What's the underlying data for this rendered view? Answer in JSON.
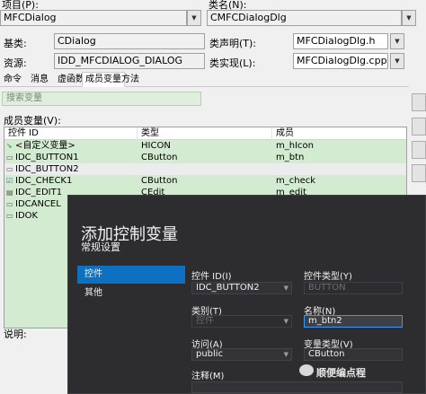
{
  "wizard": {
    "project_label": "项目(P):",
    "project_value": "MFCDialog",
    "classname_label": "类名(N):",
    "classname_value": "CMFCDialogDlg",
    "base_label": "基类:",
    "base_value": "CDialog",
    "header_label": "类声明(T):",
    "header_value": "MFCDialogDlg.h",
    "resource_label": "资源:",
    "resource_value": "IDD_MFCDIALOG_DIALOG",
    "impl_label": "类实现(L):",
    "impl_value": "MFCDialogDlg.cpp",
    "tabs": [
      "命令",
      "消息",
      "虚函数",
      "成员变量",
      "方法"
    ],
    "active_tab": "成员变量",
    "search_placeholder": "搜索变量",
    "member_vars_label": "成员变量(V):",
    "columns": [
      "控件 ID",
      "类型",
      "成员"
    ],
    "rows": [
      {
        "id": "<自定义变量>",
        "type": "HICON",
        "member": "m_hIcon",
        "icon": "green-arrow-icon"
      },
      {
        "id": "IDC_BUTTON1",
        "type": "CButton",
        "member": "m_btn",
        "icon": "button-control-icon"
      },
      {
        "id": "IDC_BUTTON2",
        "type": "",
        "member": "",
        "icon": "button-control-icon"
      },
      {
        "id": "IDC_CHECK1",
        "type": "CButton",
        "member": "m_check",
        "icon": "checkbox-control-icon"
      },
      {
        "id": "IDC_EDIT1",
        "type": "CEdit",
        "member": "m_edit",
        "icon": "edit-control-icon"
      },
      {
        "id": "IDCANCEL",
        "type": "",
        "member": "",
        "icon": "button-control-icon"
      },
      {
        "id": "IDOK",
        "type": "",
        "member": "",
        "icon": "button-control-icon"
      }
    ],
    "description_label": "说明:"
  },
  "dialog": {
    "title": "添加控制变量",
    "subtitle": "常规设置",
    "nav": [
      "控件",
      "其他"
    ],
    "nav_selected": "控件",
    "control_id_label": "控件 ID(I)",
    "control_id_value": "IDC_BUTTON2",
    "control_type_label": "控件类型(Y)",
    "control_type_value": "BUTTON",
    "category_label": "类别(T)",
    "category_value": "控件",
    "name_label": "名称(N)",
    "name_value": "m_btn2",
    "access_label": "访问(A)",
    "access_value": "public",
    "var_type_label": "变量类型(V)",
    "var_type_value": "CButton",
    "comment_label": "注释(M)"
  },
  "watermark": "顺便编点程",
  "colors": {
    "row_highlight": "#d3ebd1",
    "dialog_bg": "#2d2d30",
    "accent": "#0e70c0"
  }
}
